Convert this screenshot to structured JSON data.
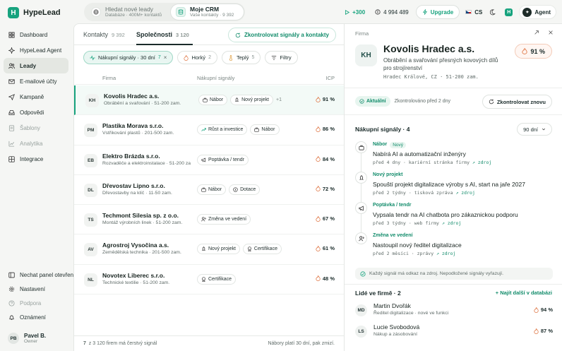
{
  "app": {
    "logo": "H",
    "name": "HypeLead"
  },
  "sidebar": {
    "items": [
      {
        "label": "Dashboard",
        "icon": "dashboard-icon"
      },
      {
        "label": "HypeLead Agent",
        "icon": "sparkle-icon"
      },
      {
        "label": "Leady",
        "icon": "people-icon"
      },
      {
        "label": "E-mailové účty",
        "icon": "mail-icon"
      },
      {
        "label": "Kampaně",
        "icon": "send-icon"
      },
      {
        "label": "Odpovědi",
        "icon": "inbox-icon"
      },
      {
        "label": "Šablony",
        "icon": "template-icon"
      },
      {
        "label": "Analytika",
        "icon": "chart-icon"
      },
      {
        "label": "Integrace",
        "icon": "grid-icon"
      }
    ],
    "bottom": [
      {
        "label": "Nechat panel otevřen",
        "icon": "panel-icon"
      },
      {
        "label": "Nastavení",
        "icon": "gear-icon"
      },
      {
        "label": "Podpora",
        "icon": "help-icon"
      },
      {
        "label": "Oznámení",
        "icon": "bell-icon"
      }
    ],
    "user": {
      "initials": "PB",
      "name": "Pavel B.",
      "role": "Owner"
    }
  },
  "topbar": {
    "search_new": {
      "title": "Hledat nové leady",
      "subtitle": "Databáze · 400M+ kontaktů"
    },
    "my_crm": {
      "title": "Moje CRM",
      "subtitle": "Vaše kontakty · 9 392"
    },
    "credits": "+300",
    "balance": "4 994 489",
    "upgrade": "Upgrade",
    "lang": "CS",
    "agent": "Agent"
  },
  "main": {
    "tabs": [
      {
        "label": "Kontakty",
        "count": "9 392"
      },
      {
        "label": "Společnosti",
        "count": "3 120"
      }
    ],
    "check_button": "Zkontrolovat signály a kontakty",
    "filters": [
      {
        "label": "Nákupní signály · 30 dní",
        "count": "7"
      },
      {
        "label": "Horký",
        "count": "2"
      },
      {
        "label": "Teplý",
        "count": "5"
      },
      {
        "label": "Filtry",
        "count": ""
      }
    ],
    "columns": {
      "firm": "Firma",
      "signals": "Nákupní signály",
      "icp": "ICP"
    },
    "rows": [
      {
        "initials": "KH",
        "name": "Kovolis Hradec a.s.",
        "sub": "Obrábění a svařování · 51-200 zam.",
        "tags": [
          {
            "label": "Nábor",
            "icon": "briefcase-icon"
          },
          {
            "label": "Nový projekt",
            "icon": "rocket-icon"
          }
        ],
        "more": "+1",
        "score": "91 %"
      },
      {
        "initials": "PM",
        "name": "Plastika Morava s.r.o.",
        "sub": "Vstřikování plastů · 201-500 zam.",
        "tags": [
          {
            "label": "Růst a investice",
            "icon": "trend-icon"
          },
          {
            "label": "Nábor",
            "icon": "briefcase-icon"
          }
        ],
        "more": "",
        "score": "86 %"
      },
      {
        "initials": "EB",
        "name": "Elektro Brázda s.r.o.",
        "sub": "Rozvaděče a elektroinstalace · 51-200 zam.",
        "tags": [
          {
            "label": "Poptávka / tendr",
            "icon": "megaphone-icon"
          }
        ],
        "more": "",
        "score": "84 %"
      },
      {
        "initials": "DL",
        "name": "Dřevostav Lipno s.r.o.",
        "sub": "Dřevostavby na klíč · 11-50 zam.",
        "tags": [
          {
            "label": "Nábor",
            "icon": "briefcase-icon"
          },
          {
            "label": "Dotace",
            "icon": "coin-icon"
          }
        ],
        "more": "",
        "score": "72 %"
      },
      {
        "initials": "TS",
        "name": "Techmont Silesia sp. z o.o.",
        "sub": "Montáž výrobních linek · 51-200 zam.",
        "tags": [
          {
            "label": "Změna ve vedení",
            "icon": "user-change-icon"
          }
        ],
        "more": "",
        "score": "67 %"
      },
      {
        "initials": "AV",
        "name": "Agrostroj Vysočina a.s.",
        "sub": "Zemědělská technika · 201-500 zam.",
        "tags": [
          {
            "label": "Nový projekt",
            "icon": "rocket-icon"
          },
          {
            "label": "Certifikace",
            "icon": "badge-icon"
          }
        ],
        "more": "",
        "score": "61 %"
      },
      {
        "initials": "NL",
        "name": "Novotex Liberec s.r.o.",
        "sub": "Technické textilie · 51-200 zam.",
        "tags": [
          {
            "label": "Certifikace",
            "icon": "badge-icon"
          }
        ],
        "more": "",
        "score": "48 %"
      }
    ],
    "footer_count": "7",
    "footer_left": "z 3 120 firem má čerstvý signál",
    "footer_right": "Nábory platí 30 dní, pak zmizí."
  },
  "detail": {
    "label": "Firma",
    "initials": "KH",
    "name": "Kovolis Hradec a.s.",
    "desc": "Obrábění a svařování přesných kovových dílů pro strojírenství",
    "location": "Hradec Králové, CZ · 51-200 zam.",
    "score": "91 %",
    "status": "Aktuální",
    "checked": "Zkontrolováno před 2 dny",
    "recheck": "Zkontrolovat znovu",
    "signals_title": "Nákupní signály · 4",
    "range": "90 dní",
    "signals": [
      {
        "type": "Nábor",
        "new": "Nový",
        "title": "Nabírá AI a automatizační inženýry",
        "ago": "před 4 dny",
        "source": "kariérní stránka firmy",
        "link": "zdroj",
        "icon": "briefcase-icon"
      },
      {
        "type": "Nový projekt",
        "new": "",
        "title": "Spouští projekt digitalizace výroby s AI, start na jaře 2027",
        "ago": "před 2 týdny",
        "source": "tisková zpráva",
        "link": "zdroj",
        "icon": "rocket-icon"
      },
      {
        "type": "Poptávka / tendr",
        "new": "",
        "title": "Vypsala tendr na AI chatbota pro zákaznickou podporu",
        "ago": "před 3 týdny",
        "source": "web firmy",
        "link": "zdroj",
        "icon": "megaphone-icon"
      },
      {
        "type": "Změna ve vedení",
        "new": "",
        "title": "Nastoupil nový ředitel digitalizace",
        "ago": "před 2 měsíci",
        "source": "zprávy",
        "link": "zdroj",
        "icon": "user-change-icon"
      }
    ],
    "note": "Každý signál má odkaz na zdroj. Nepodložené signály vyřazují.",
    "people_title": "Lidé ve firmě · 2",
    "find_more": "+ Najít další v databázi",
    "people": [
      {
        "initials": "MD",
        "name": "Martin Dvořák",
        "role": "Ředitel digitalizace · nové ve funkci",
        "score": "94 %"
      },
      {
        "initials": "LS",
        "name": "Lucie Svobodová",
        "role": "Nákup a zásobování",
        "score": "87 %"
      }
    ]
  },
  "colors": {
    "accent": "#17a37e",
    "hot": "#e07a4a"
  }
}
